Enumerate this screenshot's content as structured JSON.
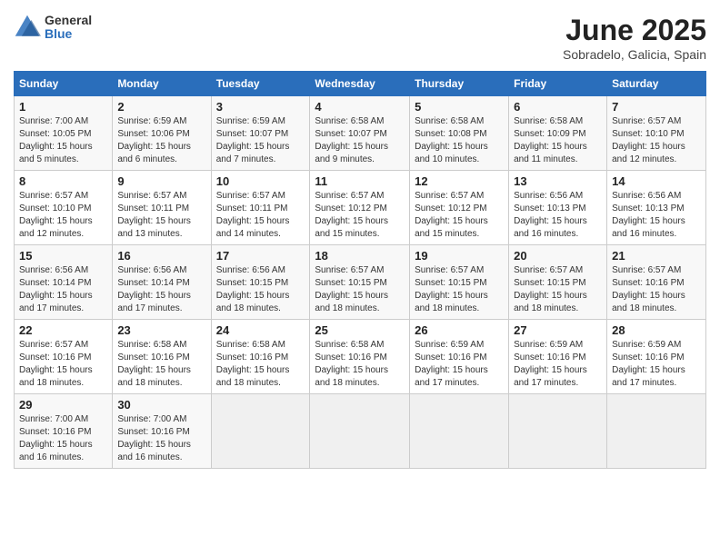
{
  "header": {
    "logo_general": "General",
    "logo_blue": "Blue",
    "month_year": "June 2025",
    "location": "Sobradelo, Galicia, Spain"
  },
  "days_of_week": [
    "Sunday",
    "Monday",
    "Tuesday",
    "Wednesday",
    "Thursday",
    "Friday",
    "Saturday"
  ],
  "weeks": [
    [
      {
        "day": "1",
        "sunrise": "7:00 AM",
        "sunset": "10:05 PM",
        "daylight": "15 hours and 5 minutes."
      },
      {
        "day": "2",
        "sunrise": "6:59 AM",
        "sunset": "10:06 PM",
        "daylight": "15 hours and 6 minutes."
      },
      {
        "day": "3",
        "sunrise": "6:59 AM",
        "sunset": "10:07 PM",
        "daylight": "15 hours and 7 minutes."
      },
      {
        "day": "4",
        "sunrise": "6:58 AM",
        "sunset": "10:07 PM",
        "daylight": "15 hours and 9 minutes."
      },
      {
        "day": "5",
        "sunrise": "6:58 AM",
        "sunset": "10:08 PM",
        "daylight": "15 hours and 10 minutes."
      },
      {
        "day": "6",
        "sunrise": "6:58 AM",
        "sunset": "10:09 PM",
        "daylight": "15 hours and 11 minutes."
      },
      {
        "day": "7",
        "sunrise": "6:57 AM",
        "sunset": "10:10 PM",
        "daylight": "15 hours and 12 minutes."
      }
    ],
    [
      {
        "day": "8",
        "sunrise": "6:57 AM",
        "sunset": "10:10 PM",
        "daylight": "15 hours and 12 minutes."
      },
      {
        "day": "9",
        "sunrise": "6:57 AM",
        "sunset": "10:11 PM",
        "daylight": "15 hours and 13 minutes."
      },
      {
        "day": "10",
        "sunrise": "6:57 AM",
        "sunset": "10:11 PM",
        "daylight": "15 hours and 14 minutes."
      },
      {
        "day": "11",
        "sunrise": "6:57 AM",
        "sunset": "10:12 PM",
        "daylight": "15 hours and 15 minutes."
      },
      {
        "day": "12",
        "sunrise": "6:57 AM",
        "sunset": "10:12 PM",
        "daylight": "15 hours and 15 minutes."
      },
      {
        "day": "13",
        "sunrise": "6:56 AM",
        "sunset": "10:13 PM",
        "daylight": "15 hours and 16 minutes."
      },
      {
        "day": "14",
        "sunrise": "6:56 AM",
        "sunset": "10:13 PM",
        "daylight": "15 hours and 16 minutes."
      }
    ],
    [
      {
        "day": "15",
        "sunrise": "6:56 AM",
        "sunset": "10:14 PM",
        "daylight": "15 hours and 17 minutes."
      },
      {
        "day": "16",
        "sunrise": "6:56 AM",
        "sunset": "10:14 PM",
        "daylight": "15 hours and 17 minutes."
      },
      {
        "day": "17",
        "sunrise": "6:56 AM",
        "sunset": "10:15 PM",
        "daylight": "15 hours and 18 minutes."
      },
      {
        "day": "18",
        "sunrise": "6:57 AM",
        "sunset": "10:15 PM",
        "daylight": "15 hours and 18 minutes."
      },
      {
        "day": "19",
        "sunrise": "6:57 AM",
        "sunset": "10:15 PM",
        "daylight": "15 hours and 18 minutes."
      },
      {
        "day": "20",
        "sunrise": "6:57 AM",
        "sunset": "10:15 PM",
        "daylight": "15 hours and 18 minutes."
      },
      {
        "day": "21",
        "sunrise": "6:57 AM",
        "sunset": "10:16 PM",
        "daylight": "15 hours and 18 minutes."
      }
    ],
    [
      {
        "day": "22",
        "sunrise": "6:57 AM",
        "sunset": "10:16 PM",
        "daylight": "15 hours and 18 minutes."
      },
      {
        "day": "23",
        "sunrise": "6:58 AM",
        "sunset": "10:16 PM",
        "daylight": "15 hours and 18 minutes."
      },
      {
        "day": "24",
        "sunrise": "6:58 AM",
        "sunset": "10:16 PM",
        "daylight": "15 hours and 18 minutes."
      },
      {
        "day": "25",
        "sunrise": "6:58 AM",
        "sunset": "10:16 PM",
        "daylight": "15 hours and 18 minutes."
      },
      {
        "day": "26",
        "sunrise": "6:59 AM",
        "sunset": "10:16 PM",
        "daylight": "15 hours and 17 minutes."
      },
      {
        "day": "27",
        "sunrise": "6:59 AM",
        "sunset": "10:16 PM",
        "daylight": "15 hours and 17 minutes."
      },
      {
        "day": "28",
        "sunrise": "6:59 AM",
        "sunset": "10:16 PM",
        "daylight": "15 hours and 17 minutes."
      }
    ],
    [
      {
        "day": "29",
        "sunrise": "7:00 AM",
        "sunset": "10:16 PM",
        "daylight": "15 hours and 16 minutes."
      },
      {
        "day": "30",
        "sunrise": "7:00 AM",
        "sunset": "10:16 PM",
        "daylight": "15 hours and 16 minutes."
      },
      null,
      null,
      null,
      null,
      null
    ]
  ]
}
